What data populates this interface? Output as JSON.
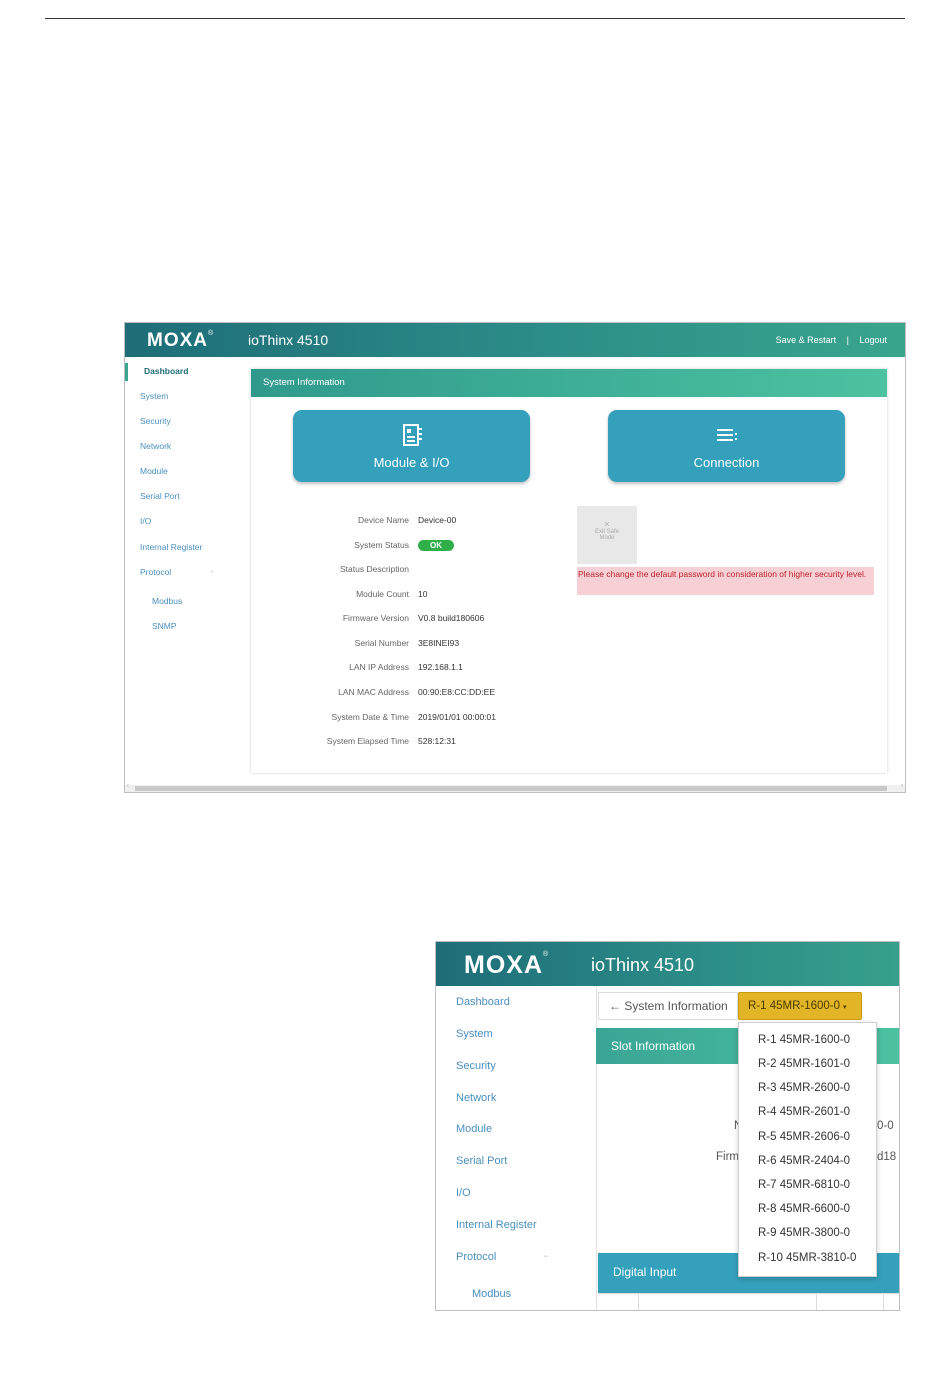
{
  "shot1": {
    "header": {
      "logo": "MOXA",
      "product": "ioThinx 4510",
      "save_restart": "Save & Restart",
      "separator": "|",
      "logout": "Logout"
    },
    "sidebar": {
      "items": [
        "Dashboard",
        "System",
        "Security",
        "Network",
        "Module",
        "Serial Port",
        "I/O",
        "Internal Register",
        "Protocol"
      ],
      "protocol_dash": "-",
      "sub_items": [
        "Modbus",
        "SNMP"
      ]
    },
    "panel": {
      "title": "System Information",
      "module_button": "Module & I/O",
      "connection_button": "Connection",
      "rows": [
        {
          "label": "Device Name",
          "value": "Device-00"
        },
        {
          "label": "System Status",
          "value": "OK"
        },
        {
          "label": "Status Description",
          "value": ""
        },
        {
          "label": "Module Count",
          "value": "10"
        },
        {
          "label": "Firmware Version",
          "value": "V0.8 build180606"
        },
        {
          "label": "Serial Number",
          "value": "3E8INEI93"
        },
        {
          "label": "LAN IP Address",
          "value": "192.168.1.1"
        },
        {
          "label": "LAN MAC Address",
          "value": "00:90:E8:CC:DD:EE"
        },
        {
          "label": "System Date & Time",
          "value": "2019/01/01 00:00:01"
        },
        {
          "label": "System Elapsed Time",
          "value": "528:12:31"
        }
      ],
      "safe_mode": {
        "x": "×",
        "line1": "Exit Safe",
        "line2": "Mode"
      },
      "warning": "Please change the default password in consideration of higher security level."
    },
    "scroll": {
      "left": "‹",
      "right": "›"
    }
  },
  "shot2": {
    "header": {
      "logo": "MOXA",
      "product": "ioThinx 4510"
    },
    "sidebar": {
      "items": [
        "Dashboard",
        "System",
        "Security",
        "Network",
        "Module",
        "Serial Port",
        "I/O",
        "Internal Register",
        "Protocol"
      ],
      "protocol_dash": "-",
      "sub_items": [
        "Modbus"
      ]
    },
    "breadcrumb": "System Information",
    "breadcrumb_arrow": "←",
    "selected_slot": "R-1 45MR-1600-0",
    "caret": "▾",
    "slot_header": "Slot Information",
    "fragments": {
      "left1": "N",
      "right1": "0-0",
      "left2": "Firm",
      "right2": "d18"
    },
    "digital_input": "Digital Input",
    "options": [
      "R-1 45MR-1600-0",
      "R-2 45MR-1601-0",
      "R-3 45MR-2600-0",
      "R-4 45MR-2601-0",
      "R-5 45MR-2606-0",
      "R-6 45MR-2404-0",
      "R-7 45MR-6810-0",
      "R-8 45MR-6600-0",
      "R-9 45MR-3800-0",
      "R-10 45MR-3810-0"
    ]
  },
  "colors": {
    "header_dark": "#1e6d78",
    "header_light": "#3aa58d",
    "button_blue": "#35a0bc",
    "ok_green": "#2eaf4a",
    "select_gold": "#e2b526",
    "warning_bg": "#f6d0d4",
    "warning_text": "#c0202d"
  }
}
